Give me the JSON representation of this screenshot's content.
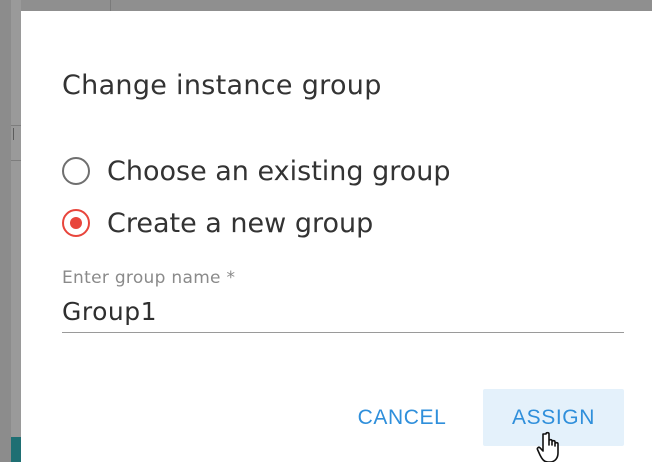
{
  "dialog": {
    "title": "Change instance group",
    "options": [
      {
        "label": "Choose an existing group",
        "selected": false
      },
      {
        "label": "Create a new group",
        "selected": true
      }
    ],
    "group_name": {
      "label": "Enter group name *",
      "value": "Group1"
    },
    "buttons": {
      "cancel": "CANCEL",
      "assign": "ASSIGN"
    }
  },
  "colors": {
    "accent_red": "#e8453c",
    "button_blue": "#2f8fdb",
    "assign_bg": "#e4f1fb",
    "text_dark": "#333333",
    "label_gray": "#8a8a8a"
  },
  "icons": {
    "cursor": "hand-pointer-icon"
  }
}
